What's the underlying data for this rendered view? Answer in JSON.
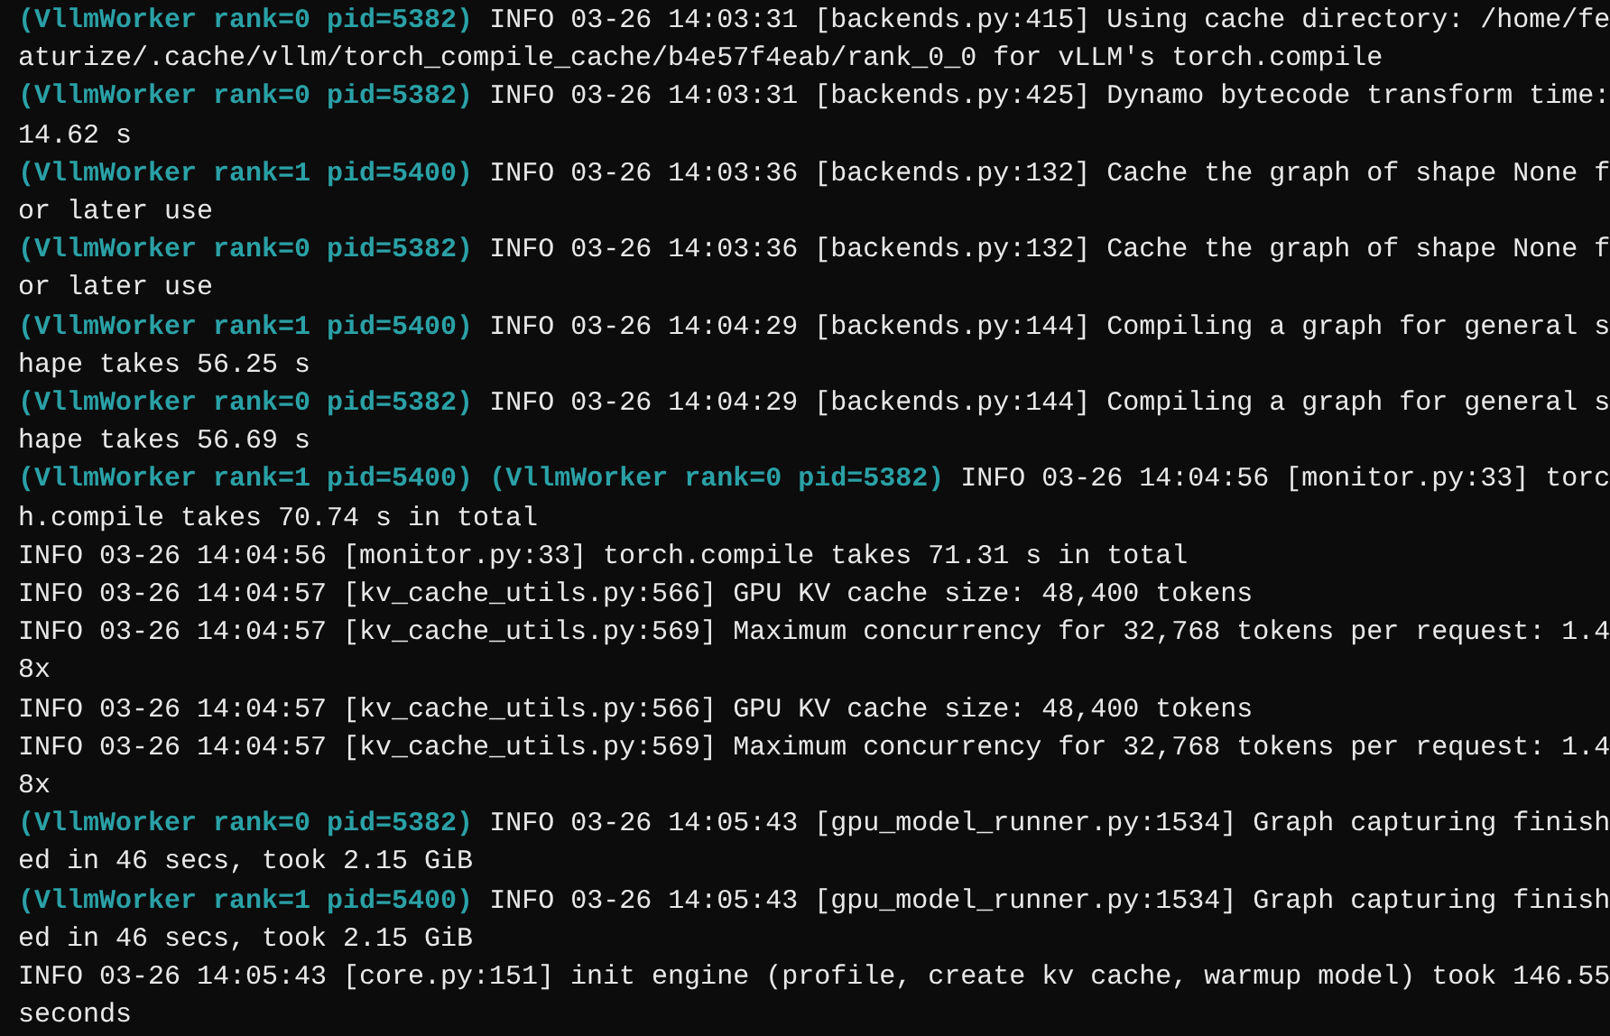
{
  "terminal": {
    "lines": [
      {
        "workers": [
          "(VllmWorker rank=0 pid=5382)"
        ],
        "message": "INFO 03-26 14:03:31 [backends.py:415] Using cache directory: /home/featurize/.cache/vllm/torch_compile_cache/b4e57f4eab/rank_0_0 for vLLM's torch.compile"
      },
      {
        "workers": [
          "(VllmWorker rank=0 pid=5382)"
        ],
        "message": "INFO 03-26 14:03:31 [backends.py:425] Dynamo bytecode transform time: 14.62 s"
      },
      {
        "workers": [
          "(VllmWorker rank=1 pid=5400)"
        ],
        "message": "INFO 03-26 14:03:36 [backends.py:132] Cache the graph of shape None for later use"
      },
      {
        "workers": [
          "(VllmWorker rank=0 pid=5382)"
        ],
        "message": "INFO 03-26 14:03:36 [backends.py:132] Cache the graph of shape None for later use"
      },
      {
        "workers": [
          "(VllmWorker rank=1 pid=5400)"
        ],
        "message": "INFO 03-26 14:04:29 [backends.py:144] Compiling a graph for general shape takes 56.25 s"
      },
      {
        "workers": [
          "(VllmWorker rank=0 pid=5382)"
        ],
        "message": "INFO 03-26 14:04:29 [backends.py:144] Compiling a graph for general shape takes 56.69 s"
      },
      {
        "workers": [
          "(VllmWorker rank=1 pid=5400)",
          "(VllmWorker rank=0 pid=5382)"
        ],
        "message": "INFO 03-26 14:04:56 [monitor.py:33] torch.compile takes 70.74 s in total"
      },
      {
        "message": "INFO 03-26 14:04:56 [monitor.py:33] torch.compile takes 71.31 s in total"
      },
      {
        "message": "INFO 03-26 14:04:57 [kv_cache_utils.py:566] GPU KV cache size: 48,400 tokens"
      },
      {
        "message": "INFO 03-26 14:04:57 [kv_cache_utils.py:569] Maximum concurrency for 32,768 tokens per request: 1.48x"
      },
      {
        "message": "INFO 03-26 14:04:57 [kv_cache_utils.py:566] GPU KV cache size: 48,400 tokens"
      },
      {
        "message": "INFO 03-26 14:04:57 [kv_cache_utils.py:569] Maximum concurrency for 32,768 tokens per request: 1.48x"
      },
      {
        "workers": [
          "(VllmWorker rank=0 pid=5382)"
        ],
        "message": "INFO 03-26 14:05:43 [gpu_model_runner.py:1534] Graph capturing finished in 46 secs, took 2.15 GiB"
      },
      {
        "workers": [
          "(VllmWorker rank=1 pid=5400)"
        ],
        "message": "INFO 03-26 14:05:43 [gpu_model_runner.py:1534] Graph capturing finished in 46 secs, took 2.15 GiB"
      },
      {
        "message": "INFO 03-26 14:05:43 [core.py:151] init engine (profile, create kv cache, warmup model) took 146.55 seconds"
      }
    ]
  }
}
